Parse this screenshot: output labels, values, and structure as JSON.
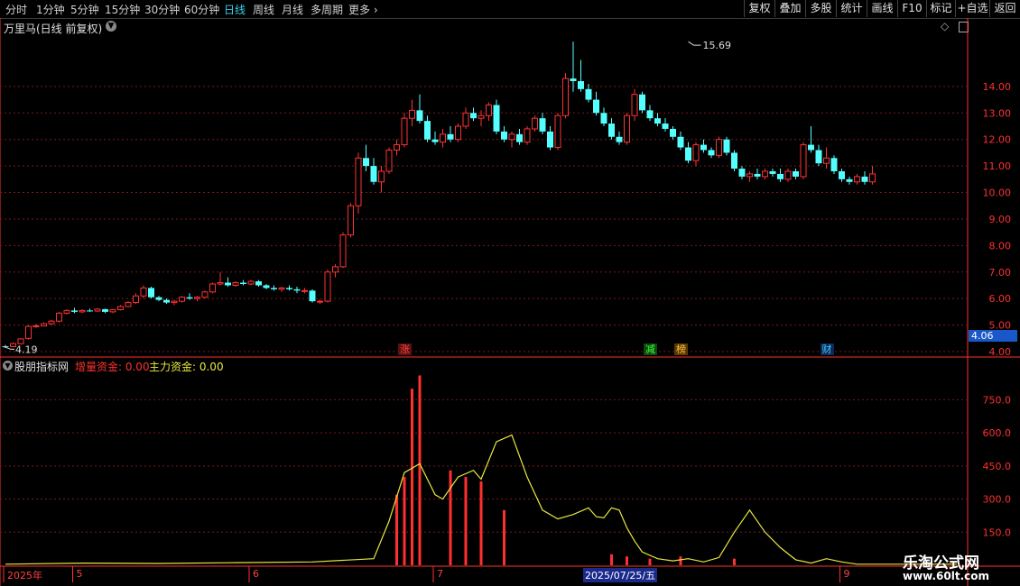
{
  "toolbar": {
    "timeframes": [
      "分时",
      "1分钟",
      "5分钟",
      "15分钟",
      "30分钟",
      "60分钟",
      "日线",
      "周线",
      "月线",
      "多周期",
      "更多"
    ],
    "active_index": 6,
    "buttons": [
      "复权",
      "叠加",
      "多股",
      "统计",
      "画线",
      "F10",
      "标记",
      "+自选",
      "返回"
    ]
  },
  "chart_title": "万里马(日线 前复权)",
  "indicator_title": "股朋指标网",
  "indicator_legend": [
    {
      "label": "增量资金: 0.00",
      "color": "#ff3030"
    },
    {
      "label": "主力资金: 0.00",
      "color": "#e8e840"
    }
  ],
  "events": [
    {
      "label": "涨",
      "color": "#ff4040",
      "bg": "#5a1010",
      "day": 52
    },
    {
      "label": "减",
      "color": "#40ff40",
      "bg": "#0a4a0a",
      "day": 84
    },
    {
      "label": "榜",
      "color": "#ffc040",
      "bg": "#5a3a00",
      "day": 88
    },
    {
      "label": "财",
      "color": "#40c8ff",
      "bg": "#0a2a5a",
      "day": 107
    }
  ],
  "current_price": "4.06",
  "date_axis": {
    "labels": [
      {
        "text": "2025年",
        "day": 0
      },
      {
        "text": "5",
        "day": 9
      },
      {
        "text": "6",
        "day": 32
      },
      {
        "text": "7",
        "day": 56
      },
      {
        "text": "9",
        "day": 109
      }
    ],
    "highlight": "2025/07/25/五",
    "highlight_day": 80
  },
  "watermark": {
    "title": "乐淘公式网",
    "url": "www.60lt.com"
  },
  "colors": {
    "up": "#ff3232",
    "down": "#54ffff",
    "grid": "#7a1a1a",
    "axis": "#ff3030",
    "line": "#e8e840"
  },
  "chart_data": [
    {
      "type": "candlestick",
      "title": "万里马(日线 前复权)",
      "ylim": [
        4.0,
        15.9
      ],
      "yticks": [
        4.0,
        5.0,
        6.0,
        7.0,
        8.0,
        9.0,
        10.0,
        11.0,
        12.0,
        13.0,
        14.0
      ],
      "high_annotation": {
        "text": "15.69",
        "value": 15.69,
        "day": 89
      },
      "low_annotation": {
        "text": "4.19",
        "value": 4.19,
        "day": 0
      },
      "ohlc": [
        [
          4.2,
          4.25,
          4.15,
          4.19
        ],
        [
          4.19,
          4.35,
          4.18,
          4.3
        ],
        [
          4.3,
          4.5,
          4.28,
          4.48
        ],
        [
          4.5,
          5.0,
          4.45,
          4.95
        ],
        [
          4.95,
          5.05,
          4.9,
          4.97
        ],
        [
          4.97,
          5.1,
          4.95,
          5.05
        ],
        [
          5.05,
          5.2,
          5.0,
          5.15
        ],
        [
          5.15,
          5.5,
          5.1,
          5.45
        ],
        [
          5.45,
          5.6,
          5.4,
          5.55
        ],
        [
          5.55,
          5.65,
          5.45,
          5.5
        ],
        [
          5.5,
          5.6,
          5.45,
          5.55
        ],
        [
          5.55,
          5.62,
          5.5,
          5.53
        ],
        [
          5.53,
          5.65,
          5.5,
          5.6
        ],
        [
          5.6,
          5.62,
          5.45,
          5.5
        ],
        [
          5.5,
          5.6,
          5.45,
          5.58
        ],
        [
          5.58,
          5.75,
          5.55,
          5.7
        ],
        [
          5.7,
          5.9,
          5.68,
          5.85
        ],
        [
          5.85,
          6.2,
          5.8,
          6.1
        ],
        [
          6.1,
          6.5,
          6.0,
          6.4
        ],
        [
          6.4,
          6.45,
          6.0,
          6.05
        ],
        [
          6.05,
          6.1,
          5.9,
          5.95
        ],
        [
          5.95,
          6.0,
          5.8,
          5.85
        ],
        [
          5.85,
          5.95,
          5.75,
          5.9
        ],
        [
          5.9,
          6.1,
          5.85,
          6.05
        ],
        [
          6.05,
          6.2,
          5.95,
          6.0
        ],
        [
          6.0,
          6.1,
          5.9,
          6.05
        ],
        [
          6.05,
          6.3,
          6.0,
          6.25
        ],
        [
          6.25,
          6.6,
          6.2,
          6.55
        ],
        [
          6.55,
          7.0,
          6.5,
          6.6
        ],
        [
          6.6,
          6.8,
          6.45,
          6.5
        ],
        [
          6.5,
          6.65,
          6.45,
          6.6
        ],
        [
          6.6,
          6.7,
          6.5,
          6.55
        ],
        [
          6.55,
          6.7,
          6.5,
          6.65
        ],
        [
          6.65,
          6.7,
          6.45,
          6.5
        ],
        [
          6.5,
          6.55,
          6.35,
          6.4
        ],
        [
          6.4,
          6.5,
          6.3,
          6.35
        ],
        [
          6.35,
          6.45,
          6.25,
          6.4
        ],
        [
          6.4,
          6.5,
          6.3,
          6.35
        ],
        [
          6.35,
          6.45,
          6.2,
          6.3
        ],
        [
          6.3,
          6.4,
          6.2,
          6.3
        ],
        [
          6.3,
          6.35,
          5.85,
          5.9
        ],
        [
          5.9,
          5.95,
          5.8,
          5.9
        ],
        [
          5.9,
          7.1,
          5.85,
          7.0
        ],
        [
          7.0,
          7.3,
          6.8,
          7.2
        ],
        [
          7.2,
          8.5,
          7.15,
          8.4
        ],
        [
          8.4,
          9.6,
          8.3,
          9.5
        ],
        [
          9.5,
          11.5,
          9.2,
          11.3
        ],
        [
          11.3,
          11.8,
          10.8,
          11.0
        ],
        [
          11.0,
          11.3,
          10.3,
          10.4
        ],
        [
          10.4,
          11.0,
          10.0,
          10.8
        ],
        [
          10.8,
          11.7,
          10.7,
          11.6
        ],
        [
          11.6,
          12.0,
          11.4,
          11.8
        ],
        [
          11.8,
          13.0,
          11.7,
          12.8
        ],
        [
          12.8,
          13.5,
          12.5,
          13.1
        ],
        [
          13.1,
          13.7,
          12.6,
          12.7
        ],
        [
          12.7,
          12.9,
          11.9,
          12.0
        ],
        [
          12.0,
          12.3,
          11.8,
          11.9
        ],
        [
          11.9,
          12.4,
          11.7,
          12.2
        ],
        [
          12.2,
          12.5,
          11.9,
          12.0
        ],
        [
          12.0,
          12.6,
          11.9,
          12.5
        ],
        [
          12.5,
          13.2,
          12.4,
          13.0
        ],
        [
          13.0,
          13.2,
          12.7,
          12.8
        ],
        [
          12.8,
          13.1,
          12.5,
          12.9
        ],
        [
          12.9,
          13.4,
          12.7,
          13.3
        ],
        [
          13.3,
          13.5,
          12.2,
          12.3
        ],
        [
          12.3,
          12.5,
          11.9,
          12.0
        ],
        [
          12.0,
          12.3,
          11.7,
          12.2
        ],
        [
          12.2,
          12.4,
          11.8,
          11.9
        ],
        [
          11.9,
          12.5,
          11.8,
          12.4
        ],
        [
          12.4,
          12.9,
          12.3,
          12.8
        ],
        [
          12.8,
          13.0,
          12.2,
          12.3
        ],
        [
          12.3,
          12.5,
          11.6,
          11.7
        ],
        [
          11.7,
          13.0,
          11.6,
          12.9
        ],
        [
          12.9,
          14.5,
          12.8,
          14.3
        ],
        [
          14.3,
          15.69,
          13.8,
          14.2
        ],
        [
          14.2,
          15.0,
          13.8,
          13.9
        ],
        [
          13.9,
          14.1,
          13.4,
          13.5
        ],
        [
          13.5,
          13.8,
          12.9,
          13.0
        ],
        [
          13.0,
          13.2,
          12.5,
          12.6
        ],
        [
          12.6,
          12.8,
          12.0,
          12.1
        ],
        [
          12.1,
          12.3,
          11.8,
          11.9
        ],
        [
          11.9,
          13.0,
          11.8,
          12.9
        ],
        [
          12.9,
          13.9,
          12.7,
          13.7
        ],
        [
          13.7,
          13.8,
          13.0,
          13.1
        ],
        [
          13.1,
          13.3,
          12.7,
          12.8
        ],
        [
          12.8,
          13.0,
          12.5,
          12.6
        ],
        [
          12.6,
          12.8,
          12.3,
          12.4
        ],
        [
          12.4,
          12.5,
          12.0,
          12.1
        ],
        [
          12.1,
          12.3,
          11.6,
          11.7
        ],
        [
          11.7,
          11.9,
          11.1,
          11.2
        ],
        [
          11.2,
          11.9,
          11.0,
          11.8
        ],
        [
          11.8,
          12.0,
          11.5,
          11.6
        ],
        [
          11.6,
          11.7,
          11.3,
          11.4
        ],
        [
          11.4,
          12.1,
          11.3,
          12.0
        ],
        [
          12.0,
          12.1,
          11.4,
          11.5
        ],
        [
          11.5,
          11.6,
          10.8,
          10.9
        ],
        [
          10.9,
          11.0,
          10.5,
          10.6
        ],
        [
          10.6,
          10.8,
          10.4,
          10.7
        ],
        [
          10.7,
          10.9,
          10.5,
          10.6
        ],
        [
          10.6,
          10.9,
          10.5,
          10.8
        ],
        [
          10.8,
          10.9,
          10.6,
          10.7
        ],
        [
          10.7,
          10.9,
          10.4,
          10.5
        ],
        [
          10.5,
          10.9,
          10.4,
          10.8
        ],
        [
          10.8,
          10.9,
          10.5,
          10.6
        ],
        [
          10.6,
          11.9,
          10.5,
          11.8
        ],
        [
          11.8,
          12.5,
          11.5,
          11.6
        ],
        [
          11.6,
          11.8,
          11.0,
          11.1
        ],
        [
          11.1,
          11.7,
          10.9,
          11.3
        ],
        [
          11.3,
          11.4,
          10.7,
          10.8
        ],
        [
          10.8,
          10.9,
          10.4,
          10.5
        ],
        [
          10.5,
          10.6,
          10.3,
          10.4
        ],
        [
          10.4,
          10.7,
          10.3,
          10.6
        ],
        [
          10.6,
          10.8,
          10.3,
          10.4
        ],
        [
          10.4,
          11.0,
          10.3,
          10.7
        ]
      ]
    },
    {
      "type": "bar_line",
      "title": "股朋指标网",
      "ylim": [
        0,
        870
      ],
      "yticks": [
        150,
        300,
        450,
        600,
        750
      ],
      "series": [
        {
          "name": "增量资金",
          "type": "bar",
          "color": "#ff3030",
          "points": [
            [
              51,
              320
            ],
            [
              52,
              400
            ],
            [
              53,
              800
            ],
            [
              54,
              860
            ],
            [
              58,
              430
            ],
            [
              60,
              400
            ],
            [
              62,
              380
            ],
            [
              65,
              250
            ],
            [
              79,
              50
            ],
            [
              81,
              40
            ],
            [
              84,
              30
            ],
            [
              88,
              40
            ],
            [
              95,
              30
            ]
          ]
        },
        {
          "name": "主力资金",
          "type": "line",
          "color": "#e8e840",
          "points": [
            [
              0,
              5
            ],
            [
              10,
              10
            ],
            [
              20,
              8
            ],
            [
              30,
              12
            ],
            [
              40,
              15
            ],
            [
              48,
              30
            ],
            [
              50,
              200
            ],
            [
              52,
              420
            ],
            [
              54,
              460
            ],
            [
              56,
              320
            ],
            [
              57,
              300
            ],
            [
              59,
              400
            ],
            [
              61,
              430
            ],
            [
              62,
              390
            ],
            [
              64,
              560
            ],
            [
              66,
              590
            ],
            [
              68,
              400
            ],
            [
              70,
              250
            ],
            [
              72,
              210
            ],
            [
              74,
              230
            ],
            [
              76,
              260
            ],
            [
              77,
              220
            ],
            [
              78,
              215
            ],
            [
              79,
              260
            ],
            [
              80,
              250
            ],
            [
              81,
              170
            ],
            [
              82,
              110
            ],
            [
              83,
              60
            ],
            [
              85,
              30
            ],
            [
              87,
              20
            ],
            [
              89,
              30
            ],
            [
              91,
              15
            ],
            [
              93,
              35
            ],
            [
              95,
              150
            ],
            [
              97,
              250
            ],
            [
              99,
              150
            ],
            [
              101,
              80
            ],
            [
              103,
              25
            ],
            [
              105,
              10
            ],
            [
              107,
              30
            ],
            [
              109,
              15
            ],
            [
              111,
              5
            ],
            [
              113,
              5
            ],
            [
              115,
              5
            ],
            [
              120,
              5
            ],
            [
              124,
              5
            ]
          ]
        }
      ]
    }
  ]
}
